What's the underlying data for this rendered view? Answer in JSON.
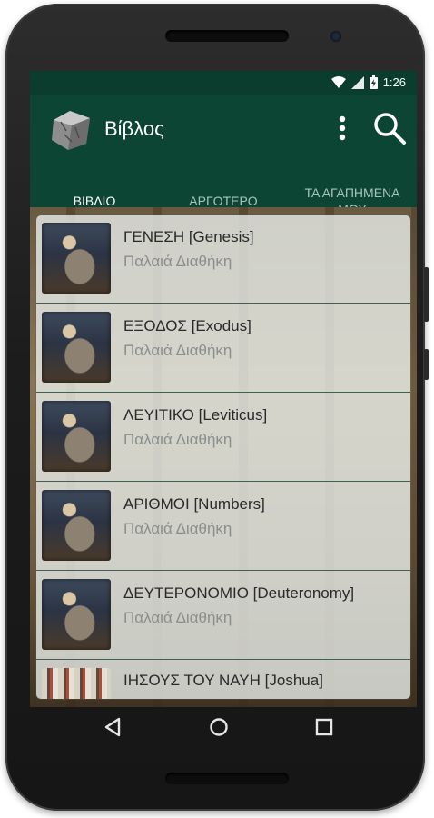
{
  "status": {
    "time": "1:26"
  },
  "app": {
    "title": "Βίβλος"
  },
  "tabs": [
    {
      "label": "ΒΙΒΛΙΟ",
      "active": true
    },
    {
      "label": "ΑΡΓΟΤΕΡΟ",
      "active": false
    },
    {
      "label": "ΤΑ ΑΓΑΠΗΜΕΝΑ ΜΟΥ",
      "active": false
    }
  ],
  "books": [
    {
      "title": "ΓΕΝΕΣΗ [Genesis]",
      "subtitle": "Παλαιά Διαθήκη"
    },
    {
      "title": "ΕΞΟΔΟΣ [Exodus]",
      "subtitle": "Παλαιά Διαθήκη"
    },
    {
      "title": "ΛΕΥΙΤΙΚΟ [Leviticus]",
      "subtitle": "Παλαιά Διαθήκη"
    },
    {
      "title": "ΑΡΙΘΜΟΙ [Numbers]",
      "subtitle": "Παλαιά Διαθήκη"
    },
    {
      "title": "ΔΕΥΤΕΡΟΝΟΜΙΟ [Deuteronomy]",
      "subtitle": "Παλαιά Διαθήκη"
    },
    {
      "title": "ΙΗΣΟΥΣ ΤΟΥ ΝΑΥΗ [Joshua]",
      "subtitle": ""
    }
  ],
  "colors": {
    "primary": "#0d4534",
    "status_bar": "#0b3d2e",
    "indicator": "#ffffff"
  },
  "icons": {
    "wifi": "wifi-icon",
    "signal": "signal-icon",
    "battery": "battery-charging-icon",
    "menu": "more-vert-icon",
    "search": "search-icon",
    "back": "back-icon",
    "home": "home-icon",
    "recents": "recents-icon"
  }
}
